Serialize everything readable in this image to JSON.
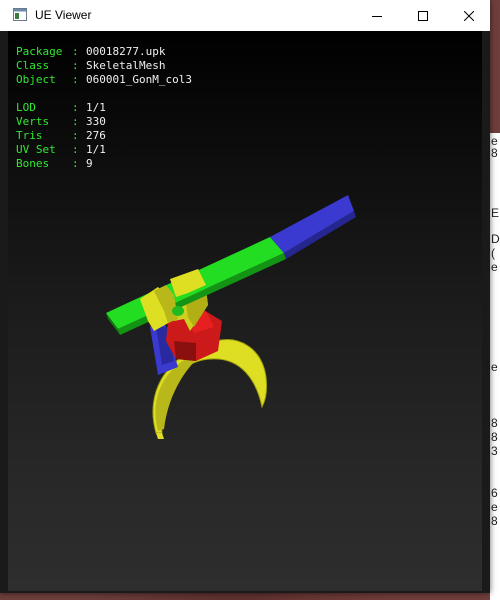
{
  "window": {
    "title": "UE Viewer",
    "icon": "app-window-icon",
    "controls": [
      "minimize-icon",
      "maximize-icon",
      "close-icon"
    ]
  },
  "info": {
    "package": {
      "label": "Package",
      "sep": ":",
      "value": "00018277.upk"
    },
    "class": {
      "label": "Class",
      "sep": ":",
      "value": "SkeletalMesh"
    },
    "object": {
      "label": "Object",
      "sep": ":",
      "value": "060001_GonM_col3"
    },
    "lod": {
      "label": "LOD",
      "sep": ":",
      "value": "1/1"
    },
    "verts": {
      "label": "Verts",
      "sep": ":",
      "value": "330"
    },
    "tris": {
      "label": "Tris",
      "sep": ":",
      "value": "276"
    },
    "uvset": {
      "label": "UV Set",
      "sep": ":",
      "value": "1/1"
    },
    "bones": {
      "label": "Bones",
      "sep": ":",
      "value": "9"
    }
  },
  "background_strip": {
    "fragments": [
      "e",
      "8",
      "E",
      "D",
      "(",
      "e",
      "e",
      "8",
      "8",
      "3",
      "6",
      "e",
      "8"
    ]
  },
  "colors": {
    "label_green": "#31e831",
    "value_white": "#f0f0f0",
    "mesh_green": "#22dd22",
    "mesh_blue": "#3a3ad0",
    "mesh_yellow": "#dede22",
    "mesh_red": "#cc1a1a"
  }
}
